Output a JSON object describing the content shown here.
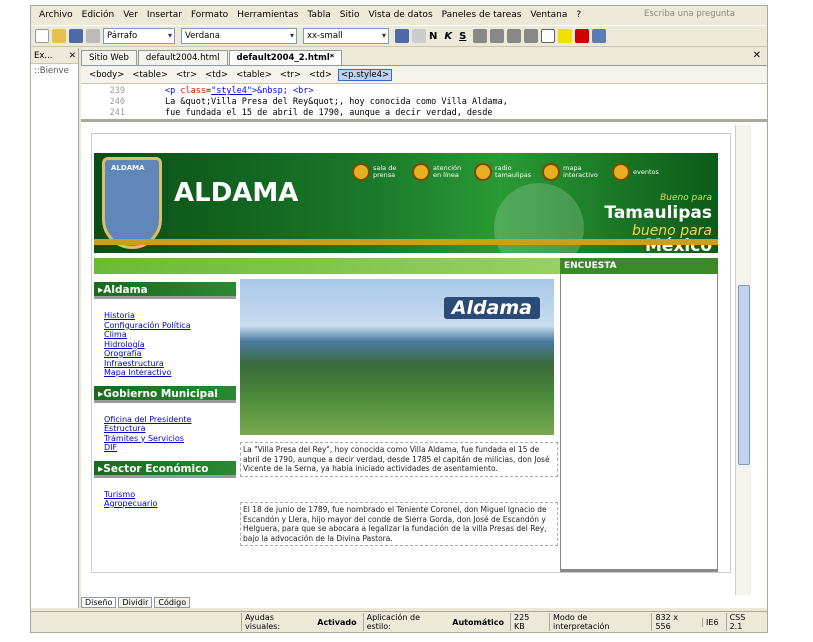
{
  "menubar": {
    "items": [
      "Archivo",
      "Edición",
      "Ver",
      "Insertar",
      "Formato",
      "Herramientas",
      "Tabla",
      "Sitio",
      "Vista de datos",
      "Paneles de tareas",
      "Ventana",
      "?"
    ],
    "ask": "Escriba una pregunta"
  },
  "toolbar": {
    "style": "Párrafo",
    "font": "Verdana",
    "size": "xx-small",
    "bold": "N",
    "italic": "K",
    "strike": "S"
  },
  "leftpane": {
    "title": "Ex...",
    "item": "Bienve"
  },
  "tabs": [
    "Sitio Web",
    "default2004.html",
    "default2004_2.html*"
  ],
  "tagbar": [
    "<body>",
    "<table>",
    "<tr>",
    "<td>",
    "<table>",
    "<tr>",
    "<td>",
    "<p.style4>"
  ],
  "code": {
    "lines": [
      {
        "n": "239",
        "pre": "<p ",
        "attr": "class",
        "val": "\"style4\"",
        "post": ">&nbsp; <br>"
      },
      {
        "n": "240",
        "text": "La &quot;Villa Presa del Rey&quot;, hoy conocida como Villa Aldama,"
      },
      {
        "n": "241",
        "text": "fue fundada el 15 de abril de 1790, aunque a decir verdad, desde"
      }
    ]
  },
  "page": {
    "banner_title": "ALDAMA",
    "shield_label": "ALDAMA",
    "menu": [
      "sala de prensa",
      "atención en línea",
      "radio tamaulipas",
      "mapa interactivo",
      "eventos"
    ],
    "tam": {
      "b1": "Bueno para",
      "b2": "Tamaulipas",
      "b3": "bueno para",
      "b4": "México"
    },
    "encuesta": "ENCUESTA",
    "sections": [
      {
        "title": "▸Aldama",
        "links": [
          "Historia",
          "Configuración Política",
          "Clima",
          "Hidrología",
          "Orografía",
          "Infraestructura",
          "Mapa Interactivo"
        ]
      },
      {
        "title": "▸Gobierno Municipal",
        "links": [
          "Oficina del Presidente",
          "Estructura",
          "Trámites y Servicios",
          "DIF"
        ]
      },
      {
        "title": "▸Sector Económico",
        "links": [
          "Turismo",
          "Agropecuario"
        ]
      }
    ],
    "photo_title": "Aldama",
    "text1": "La \"Villa Presa del Rey\", hoy conocida como Villa Aldama, fue fundada el 15 de abril de 1790, aunque a decir verdad, desde 1785 el capitán de milicias, don José Vicente de la Serna, ya había iniciado actividades de asentamiento.",
    "text2": "El 18 de junio de 1789, fue nombrado el Teniente Coronel, don Miguel Ignacio de Escandón y Llera, hijo mayor del conde de Sierra Gorda, don José de Escandón y Helguera, para que se abocara a legalizar la fundación de la villa Presas del Rey, bajo la advocación de la Divina Pastora."
  },
  "viewtabs": [
    "Diseño",
    "Dividir",
    "Código"
  ],
  "status": {
    "ayudas": "Ayudas visuales:",
    "activado": "Activado",
    "aplic": "Aplicación de estilo:",
    "auto": "Automático",
    "size": "225 KB",
    "mode": "Modo de interpretación",
    "dims": "832 x 556",
    "ie": "IE6",
    "css": "CSS 2.1"
  }
}
